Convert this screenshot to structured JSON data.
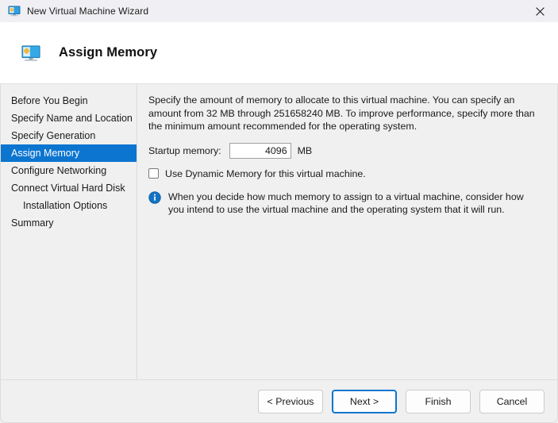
{
  "window": {
    "title": "New Virtual Machine Wizard",
    "title_icon": "virtual-machine-icon",
    "close_icon": "close-icon"
  },
  "header": {
    "title": "Assign Memory",
    "icon": "virtual-machine-icon"
  },
  "sidebar": {
    "items": [
      {
        "label": "Before You Begin",
        "selected": false,
        "indent": false
      },
      {
        "label": "Specify Name and Location",
        "selected": false,
        "indent": false
      },
      {
        "label": "Specify Generation",
        "selected": false,
        "indent": false
      },
      {
        "label": "Assign Memory",
        "selected": true,
        "indent": false
      },
      {
        "label": "Configure Networking",
        "selected": false,
        "indent": false
      },
      {
        "label": "Connect Virtual Hard Disk",
        "selected": false,
        "indent": false
      },
      {
        "label": "Installation Options",
        "selected": false,
        "indent": true
      },
      {
        "label": "Summary",
        "selected": false,
        "indent": false
      }
    ]
  },
  "content": {
    "description": "Specify the amount of memory to allocate to this virtual machine. You can specify an amount from 32 MB through 251658240 MB. To improve performance, specify more than the minimum amount recommended for the operating system.",
    "startup_memory_label": "Startup memory:",
    "startup_memory_value": "4096",
    "startup_memory_placeholder": "",
    "startup_memory_unit": "MB",
    "dynamic_memory_label": "Use Dynamic Memory for this virtual machine.",
    "dynamic_memory_checked": false,
    "note_icon": "info-icon",
    "note_text": "When you decide how much memory to assign to a virtual machine, consider how you intend to use the virtual machine and the operating system that it will run."
  },
  "footer": {
    "previous_label": "< Previous",
    "next_label": "Next >",
    "finish_label": "Finish",
    "cancel_label": "Cancel",
    "focused_button": "next"
  },
  "colors": {
    "accent": "#0c75d0",
    "selection": "#0c75d0",
    "background": "#f0f0f0",
    "titlebar": "#f0f0f4",
    "header": "#ffffff"
  }
}
